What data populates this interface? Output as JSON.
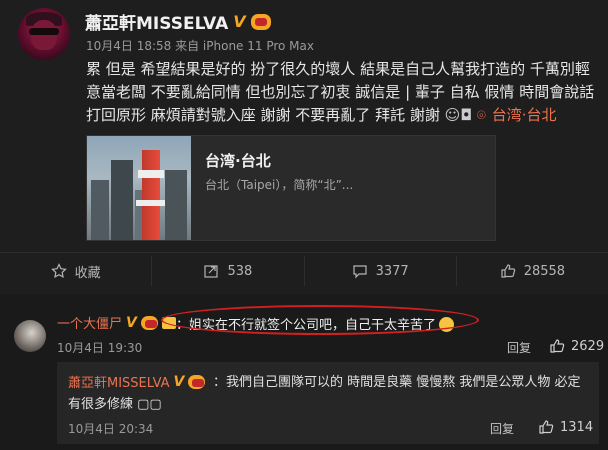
{
  "post": {
    "author": "蕭亞軒MISSELVA",
    "verified_mark": "V",
    "meta": "10月4日 18:58 来自 iPhone 11 Pro Max",
    "text": "累 但是 希望結果是好的 扮了很久的壞人 結果是自己人幫我打造的 千萬別輕意當老闆 不要亂給同情 但也別忘了初衷 誠信是 | 輩子 自私 假情 時間會說話 打回原形 麻煩請對號入座 謝謝 不要再亂了 拜託 謝謝",
    "location": "台湾·台北",
    "card": {
      "title": "台湾·台北",
      "desc": "台北（Taipei），简称“北”..."
    }
  },
  "actions": {
    "favorite": "收藏",
    "repost": "538",
    "comment": "3377",
    "like": "28558"
  },
  "comments": [
    {
      "author": "一个大僵尸",
      "verified_mark": "V",
      "text": "：姐实在不行就签个公司吧，自己干太辛苦了",
      "time": "10月4日 19:30",
      "reply_label": "回复",
      "likes": "2629"
    }
  ],
  "reply": {
    "author": "蕭亞軒MISSELVA",
    "verified_mark": "V",
    "text": "：我們自己團隊可以的 時間是良藥 慢慢熬 我們是公眾人物 必定有很多修練 ▢▢",
    "time": "10月4日 20:34",
    "reply_label": "回复",
    "likes": "1314"
  },
  "colors": {
    "accent": "#eb7350",
    "vip": "#f6a623",
    "highlight": "#d02020"
  }
}
